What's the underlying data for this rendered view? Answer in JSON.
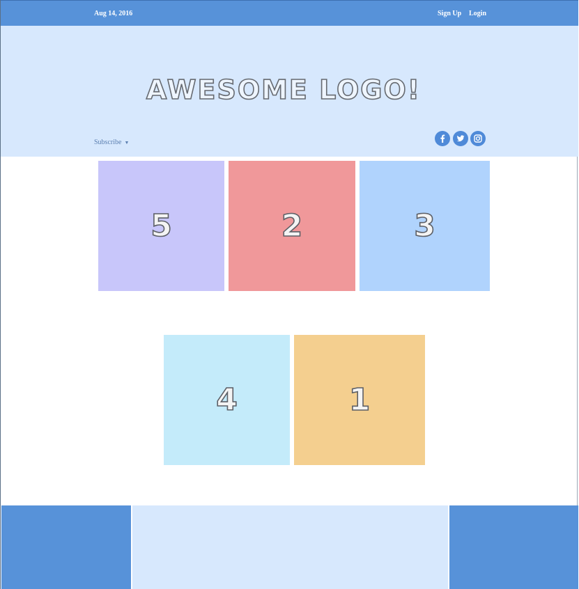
{
  "topbar": {
    "date": "Aug 14, 2016",
    "sign_up": "Sign Up",
    "login": "Login"
  },
  "header": {
    "logo": "AWESOME LOGO!",
    "subscribe": "Subscribe",
    "subscribe_caret": "▼",
    "social_icons": [
      "facebook-icon",
      "twitter-icon",
      "instagram-icon"
    ]
  },
  "tiles": [
    {
      "label": "5",
      "color": "#c8c6fa"
    },
    {
      "label": "2",
      "color": "#f0989a"
    },
    {
      "label": "3",
      "color": "#b0d3fd"
    },
    {
      "label": "4",
      "color": "#c4ebfa"
    },
    {
      "label": "1",
      "color": "#f4cf8f"
    }
  ],
  "colors": {
    "accent": "#5792d9",
    "header_bg": "#d7e8fd"
  }
}
